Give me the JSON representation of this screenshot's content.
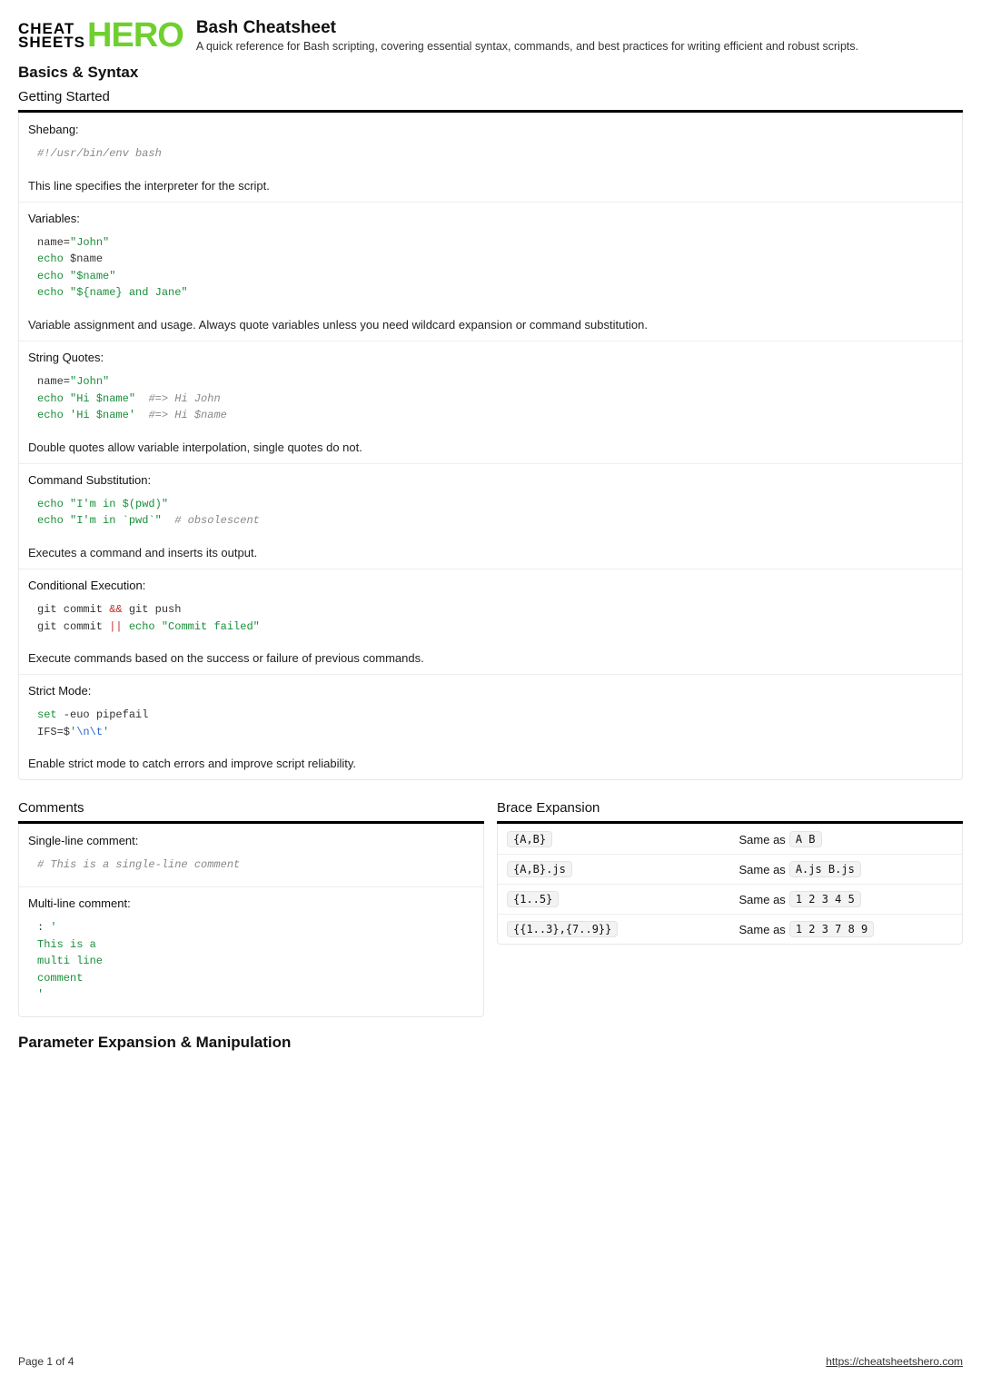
{
  "logo": {
    "left1": "CHEAT",
    "left2": "SHEETS",
    "right": "HERO"
  },
  "page": {
    "title": "Bash Cheatsheet",
    "subtitle": "A quick reference for Bash scripting, covering essential syntax, commands, and best practices for writing efficient and robust scripts."
  },
  "section1": {
    "title": "Basics & Syntax"
  },
  "getting_started": {
    "heading": "Getting Started",
    "items": {
      "shebang": {
        "label": "Shebang:",
        "code": "#!/usr/bin/env bash",
        "desc": "This line specifies the interpreter for the script."
      },
      "variables": {
        "label": "Variables:",
        "desc": "Variable assignment and usage. Always quote variables unless you need wildcard expansion or command substitution."
      },
      "string_quotes": {
        "label": "String Quotes:",
        "desc": "Double quotes allow variable interpolation, single quotes do not."
      },
      "command_sub": {
        "label": "Command Substitution:",
        "desc": "Executes a command and inserts its output."
      },
      "conditional": {
        "label": "Conditional Execution:",
        "desc": "Execute commands based on the success or failure of previous commands."
      },
      "strict": {
        "label": "Strict Mode:",
        "desc": "Enable strict mode to catch errors and improve script reliability."
      }
    }
  },
  "comments": {
    "heading": "Comments",
    "single": {
      "label": "Single-line comment:",
      "code": "# This is a single-line comment"
    },
    "multi": {
      "label": "Multi-line comment:"
    }
  },
  "brace": {
    "heading": "Brace Expansion",
    "rows": [
      {
        "expr": "{A,B}",
        "prefix": "Same as ",
        "result": "A B"
      },
      {
        "expr": "{A,B}.js",
        "prefix": "Same as ",
        "result": "A.js B.js"
      },
      {
        "expr": "{1..5}",
        "prefix": "Same as ",
        "result": "1 2 3 4 5"
      },
      {
        "expr": "{{1..3},{7..9}}",
        "prefix": "Same as ",
        "result": "1 2 3 7 8 9"
      }
    ]
  },
  "section2": {
    "title": "Parameter Expansion & Manipulation"
  },
  "footer": {
    "page": "Page 1 of 4",
    "url": "https://cheatsheetshero.com"
  }
}
